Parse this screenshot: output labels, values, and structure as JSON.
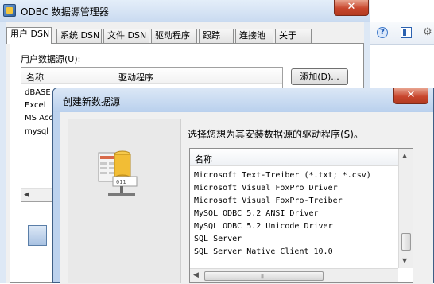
{
  "odbc_window": {
    "title": "ODBC 数据源管理器",
    "close_glyph": "✕",
    "tabs": [
      {
        "label": "用户 DSN",
        "active": true
      },
      {
        "label": "系统 DSN",
        "active": false
      },
      {
        "label": "文件 DSN",
        "active": false
      },
      {
        "label": "驱动程序",
        "active": false
      },
      {
        "label": "跟踪",
        "active": false
      },
      {
        "label": "连接池",
        "active": false
      },
      {
        "label": "关于",
        "active": false
      }
    ],
    "user_ds_label": "用户数据源(U):",
    "columns": {
      "name": "名称",
      "driver": "驱动程序"
    },
    "rows": [
      {
        "name": "dBASE"
      },
      {
        "name": "Excel"
      },
      {
        "name": "MS Acc"
      },
      {
        "name": "mysql"
      }
    ],
    "add_button": "添加(D)..."
  },
  "create_dialog": {
    "title": "创建新数据源",
    "close_glyph": "✕",
    "prompt": "选择您想为其安装数据源的驱动程序(S)。",
    "list_header": "名称",
    "drivers": [
      "Microsoft Text-Treiber (*.txt; *.csv)",
      "Microsoft Visual FoxPro Driver",
      "Microsoft Visual FoxPro-Treiber",
      "MySQL ODBC 5.2 ANSI Driver",
      "MySQL ODBC 5.2 Unicode Driver",
      "SQL Server",
      "SQL Server Native Client 10.0"
    ]
  },
  "background_toolbar": {
    "icons": [
      "help-icon",
      "frame-icon",
      "gear-icon"
    ],
    "help_glyph": "?",
    "gear_glyph": "⚙"
  },
  "colors": {
    "window_frame": "#dde8f5",
    "dialog_frame": "#bcd2ee",
    "close_button": "#c8462d"
  }
}
